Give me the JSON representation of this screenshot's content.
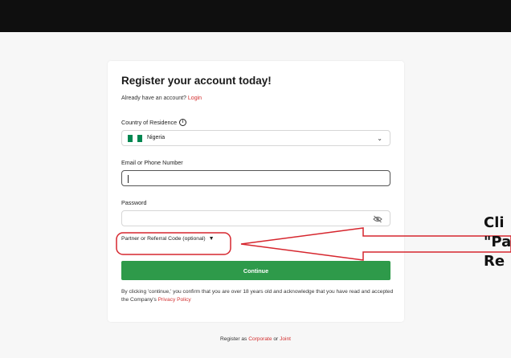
{
  "form": {
    "title": "Register your account today!",
    "already_text": "Already have an account?",
    "login_link": "Login",
    "country_label": "Country of Residence",
    "info_glyph": "i",
    "country_value": "Nigeria",
    "country_chevron": "⌄",
    "email_label": "Email or Phone Number",
    "email_value": "",
    "password_label": "Password",
    "password_value": "",
    "referral_label": "Partner or Referral Code (optional)",
    "referral_toggle": "▼",
    "continue_label": "Continue",
    "terms_text": "By clicking 'continue,' you confirm that you are over 18 years old and acknowledge that you have read and accepted the Company's",
    "privacy_link": "Privacy Policy"
  },
  "footer": {
    "prefix": "Register as",
    "corporate": "Corporate",
    "or": "or",
    "joint": "Joint"
  },
  "annotation": {
    "line1": "Cli",
    "line2": "\"Pa",
    "line3": "Re"
  },
  "colors": {
    "accent_red": "#d32f2f",
    "continue_green": "#2e9a4a",
    "flag_green": "#008751",
    "topbar": "#0f0f0f"
  }
}
